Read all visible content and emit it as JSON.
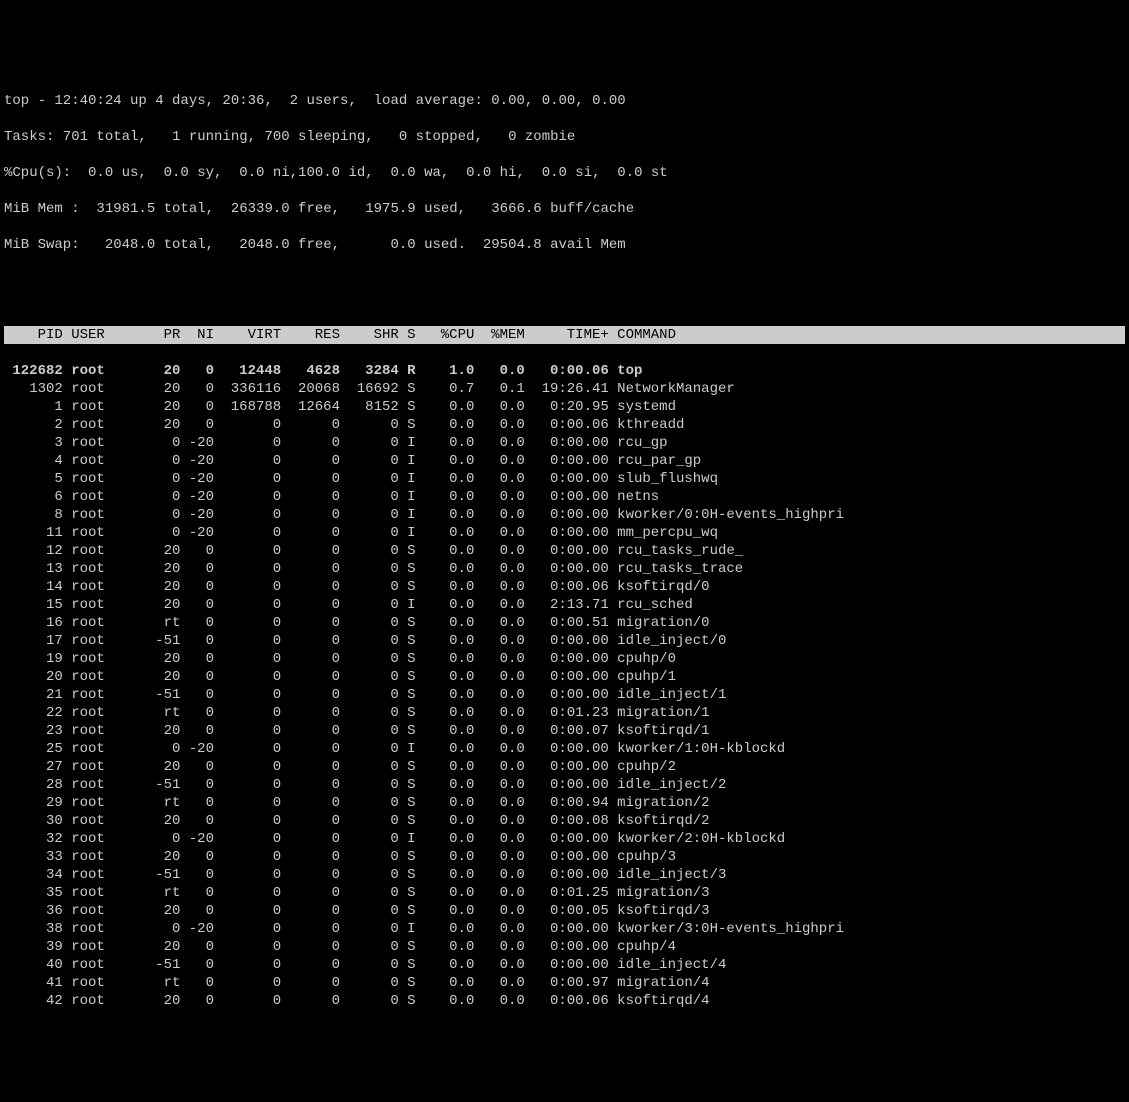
{
  "summary": {
    "line1": "top - 12:40:24 up 4 days, 20:36,  2 users,  load average: 0.00, 0.00, 0.00",
    "line2": "Tasks: 701 total,   1 running, 700 sleeping,   0 stopped,   0 zombie",
    "line3": "%Cpu(s):  0.0 us,  0.0 sy,  0.0 ni,100.0 id,  0.0 wa,  0.0 hi,  0.0 si,  0.0 st",
    "line4": "MiB Mem :  31981.5 total,  26339.0 free,   1975.9 used,   3666.6 buff/cache",
    "line5": "MiB Swap:   2048.0 total,   2048.0 free,      0.0 used.  29504.8 avail Mem"
  },
  "columns": {
    "pid": "PID",
    "user": "USER",
    "pr": "PR",
    "ni": "NI",
    "virt": "VIRT",
    "res": "RES",
    "shr": "SHR",
    "s": "S",
    "cpu": "%CPU",
    "mem": "%MEM",
    "time": "TIME+",
    "cmd": "COMMAND"
  },
  "processes": [
    {
      "pid": "122682",
      "user": "root",
      "pr": "20",
      "ni": "0",
      "virt": "12448",
      "res": "4628",
      "shr": "3284",
      "s": "R",
      "cpu": "1.0",
      "mem": "0.0",
      "time": "0:00.06",
      "cmd": "top",
      "hl": true
    },
    {
      "pid": "1302",
      "user": "root",
      "pr": "20",
      "ni": "0",
      "virt": "336116",
      "res": "20068",
      "shr": "16692",
      "s": "S",
      "cpu": "0.7",
      "mem": "0.1",
      "time": "19:26.41",
      "cmd": "NetworkManager"
    },
    {
      "pid": "1",
      "user": "root",
      "pr": "20",
      "ni": "0",
      "virt": "168788",
      "res": "12664",
      "shr": "8152",
      "s": "S",
      "cpu": "0.0",
      "mem": "0.0",
      "time": "0:20.95",
      "cmd": "systemd"
    },
    {
      "pid": "2",
      "user": "root",
      "pr": "20",
      "ni": "0",
      "virt": "0",
      "res": "0",
      "shr": "0",
      "s": "S",
      "cpu": "0.0",
      "mem": "0.0",
      "time": "0:00.06",
      "cmd": "kthreadd"
    },
    {
      "pid": "3",
      "user": "root",
      "pr": "0",
      "ni": "-20",
      "virt": "0",
      "res": "0",
      "shr": "0",
      "s": "I",
      "cpu": "0.0",
      "mem": "0.0",
      "time": "0:00.00",
      "cmd": "rcu_gp"
    },
    {
      "pid": "4",
      "user": "root",
      "pr": "0",
      "ni": "-20",
      "virt": "0",
      "res": "0",
      "shr": "0",
      "s": "I",
      "cpu": "0.0",
      "mem": "0.0",
      "time": "0:00.00",
      "cmd": "rcu_par_gp"
    },
    {
      "pid": "5",
      "user": "root",
      "pr": "0",
      "ni": "-20",
      "virt": "0",
      "res": "0",
      "shr": "0",
      "s": "I",
      "cpu": "0.0",
      "mem": "0.0",
      "time": "0:00.00",
      "cmd": "slub_flushwq"
    },
    {
      "pid": "6",
      "user": "root",
      "pr": "0",
      "ni": "-20",
      "virt": "0",
      "res": "0",
      "shr": "0",
      "s": "I",
      "cpu": "0.0",
      "mem": "0.0",
      "time": "0:00.00",
      "cmd": "netns"
    },
    {
      "pid": "8",
      "user": "root",
      "pr": "0",
      "ni": "-20",
      "virt": "0",
      "res": "0",
      "shr": "0",
      "s": "I",
      "cpu": "0.0",
      "mem": "0.0",
      "time": "0:00.00",
      "cmd": "kworker/0:0H-events_highpri"
    },
    {
      "pid": "11",
      "user": "root",
      "pr": "0",
      "ni": "-20",
      "virt": "0",
      "res": "0",
      "shr": "0",
      "s": "I",
      "cpu": "0.0",
      "mem": "0.0",
      "time": "0:00.00",
      "cmd": "mm_percpu_wq"
    },
    {
      "pid": "12",
      "user": "root",
      "pr": "20",
      "ni": "0",
      "virt": "0",
      "res": "0",
      "shr": "0",
      "s": "S",
      "cpu": "0.0",
      "mem": "0.0",
      "time": "0:00.00",
      "cmd": "rcu_tasks_rude_"
    },
    {
      "pid": "13",
      "user": "root",
      "pr": "20",
      "ni": "0",
      "virt": "0",
      "res": "0",
      "shr": "0",
      "s": "S",
      "cpu": "0.0",
      "mem": "0.0",
      "time": "0:00.00",
      "cmd": "rcu_tasks_trace"
    },
    {
      "pid": "14",
      "user": "root",
      "pr": "20",
      "ni": "0",
      "virt": "0",
      "res": "0",
      "shr": "0",
      "s": "S",
      "cpu": "0.0",
      "mem": "0.0",
      "time": "0:00.06",
      "cmd": "ksoftirqd/0"
    },
    {
      "pid": "15",
      "user": "root",
      "pr": "20",
      "ni": "0",
      "virt": "0",
      "res": "0",
      "shr": "0",
      "s": "I",
      "cpu": "0.0",
      "mem": "0.0",
      "time": "2:13.71",
      "cmd": "rcu_sched"
    },
    {
      "pid": "16",
      "user": "root",
      "pr": "rt",
      "ni": "0",
      "virt": "0",
      "res": "0",
      "shr": "0",
      "s": "S",
      "cpu": "0.0",
      "mem": "0.0",
      "time": "0:00.51",
      "cmd": "migration/0"
    },
    {
      "pid": "17",
      "user": "root",
      "pr": "-51",
      "ni": "0",
      "virt": "0",
      "res": "0",
      "shr": "0",
      "s": "S",
      "cpu": "0.0",
      "mem": "0.0",
      "time": "0:00.00",
      "cmd": "idle_inject/0"
    },
    {
      "pid": "19",
      "user": "root",
      "pr": "20",
      "ni": "0",
      "virt": "0",
      "res": "0",
      "shr": "0",
      "s": "S",
      "cpu": "0.0",
      "mem": "0.0",
      "time": "0:00.00",
      "cmd": "cpuhp/0"
    },
    {
      "pid": "20",
      "user": "root",
      "pr": "20",
      "ni": "0",
      "virt": "0",
      "res": "0",
      "shr": "0",
      "s": "S",
      "cpu": "0.0",
      "mem": "0.0",
      "time": "0:00.00",
      "cmd": "cpuhp/1"
    },
    {
      "pid": "21",
      "user": "root",
      "pr": "-51",
      "ni": "0",
      "virt": "0",
      "res": "0",
      "shr": "0",
      "s": "S",
      "cpu": "0.0",
      "mem": "0.0",
      "time": "0:00.00",
      "cmd": "idle_inject/1"
    },
    {
      "pid": "22",
      "user": "root",
      "pr": "rt",
      "ni": "0",
      "virt": "0",
      "res": "0",
      "shr": "0",
      "s": "S",
      "cpu": "0.0",
      "mem": "0.0",
      "time": "0:01.23",
      "cmd": "migration/1"
    },
    {
      "pid": "23",
      "user": "root",
      "pr": "20",
      "ni": "0",
      "virt": "0",
      "res": "0",
      "shr": "0",
      "s": "S",
      "cpu": "0.0",
      "mem": "0.0",
      "time": "0:00.07",
      "cmd": "ksoftirqd/1"
    },
    {
      "pid": "25",
      "user": "root",
      "pr": "0",
      "ni": "-20",
      "virt": "0",
      "res": "0",
      "shr": "0",
      "s": "I",
      "cpu": "0.0",
      "mem": "0.0",
      "time": "0:00.00",
      "cmd": "kworker/1:0H-kblockd"
    },
    {
      "pid": "27",
      "user": "root",
      "pr": "20",
      "ni": "0",
      "virt": "0",
      "res": "0",
      "shr": "0",
      "s": "S",
      "cpu": "0.0",
      "mem": "0.0",
      "time": "0:00.00",
      "cmd": "cpuhp/2"
    },
    {
      "pid": "28",
      "user": "root",
      "pr": "-51",
      "ni": "0",
      "virt": "0",
      "res": "0",
      "shr": "0",
      "s": "S",
      "cpu": "0.0",
      "mem": "0.0",
      "time": "0:00.00",
      "cmd": "idle_inject/2"
    },
    {
      "pid": "29",
      "user": "root",
      "pr": "rt",
      "ni": "0",
      "virt": "0",
      "res": "0",
      "shr": "0",
      "s": "S",
      "cpu": "0.0",
      "mem": "0.0",
      "time": "0:00.94",
      "cmd": "migration/2"
    },
    {
      "pid": "30",
      "user": "root",
      "pr": "20",
      "ni": "0",
      "virt": "0",
      "res": "0",
      "shr": "0",
      "s": "S",
      "cpu": "0.0",
      "mem": "0.0",
      "time": "0:00.08",
      "cmd": "ksoftirqd/2"
    },
    {
      "pid": "32",
      "user": "root",
      "pr": "0",
      "ni": "-20",
      "virt": "0",
      "res": "0",
      "shr": "0",
      "s": "I",
      "cpu": "0.0",
      "mem": "0.0",
      "time": "0:00.00",
      "cmd": "kworker/2:0H-kblockd"
    },
    {
      "pid": "33",
      "user": "root",
      "pr": "20",
      "ni": "0",
      "virt": "0",
      "res": "0",
      "shr": "0",
      "s": "S",
      "cpu": "0.0",
      "mem": "0.0",
      "time": "0:00.00",
      "cmd": "cpuhp/3"
    },
    {
      "pid": "34",
      "user": "root",
      "pr": "-51",
      "ni": "0",
      "virt": "0",
      "res": "0",
      "shr": "0",
      "s": "S",
      "cpu": "0.0",
      "mem": "0.0",
      "time": "0:00.00",
      "cmd": "idle_inject/3"
    },
    {
      "pid": "35",
      "user": "root",
      "pr": "rt",
      "ni": "0",
      "virt": "0",
      "res": "0",
      "shr": "0",
      "s": "S",
      "cpu": "0.0",
      "mem": "0.0",
      "time": "0:01.25",
      "cmd": "migration/3"
    },
    {
      "pid": "36",
      "user": "root",
      "pr": "20",
      "ni": "0",
      "virt": "0",
      "res": "0",
      "shr": "0",
      "s": "S",
      "cpu": "0.0",
      "mem": "0.0",
      "time": "0:00.05",
      "cmd": "ksoftirqd/3"
    },
    {
      "pid": "38",
      "user": "root",
      "pr": "0",
      "ni": "-20",
      "virt": "0",
      "res": "0",
      "shr": "0",
      "s": "I",
      "cpu": "0.0",
      "mem": "0.0",
      "time": "0:00.00",
      "cmd": "kworker/3:0H-events_highpri"
    },
    {
      "pid": "39",
      "user": "root",
      "pr": "20",
      "ni": "0",
      "virt": "0",
      "res": "0",
      "shr": "0",
      "s": "S",
      "cpu": "0.0",
      "mem": "0.0",
      "time": "0:00.00",
      "cmd": "cpuhp/4"
    },
    {
      "pid": "40",
      "user": "root",
      "pr": "-51",
      "ni": "0",
      "virt": "0",
      "res": "0",
      "shr": "0",
      "s": "S",
      "cpu": "0.0",
      "mem": "0.0",
      "time": "0:00.00",
      "cmd": "idle_inject/4"
    },
    {
      "pid": "41",
      "user": "root",
      "pr": "rt",
      "ni": "0",
      "virt": "0",
      "res": "0",
      "shr": "0",
      "s": "S",
      "cpu": "0.0",
      "mem": "0.0",
      "time": "0:00.97",
      "cmd": "migration/4"
    },
    {
      "pid": "42",
      "user": "root",
      "pr": "20",
      "ni": "0",
      "virt": "0",
      "res": "0",
      "shr": "0",
      "s": "S",
      "cpu": "0.0",
      "mem": "0.0",
      "time": "0:00.06",
      "cmd": "ksoftirqd/4"
    }
  ]
}
